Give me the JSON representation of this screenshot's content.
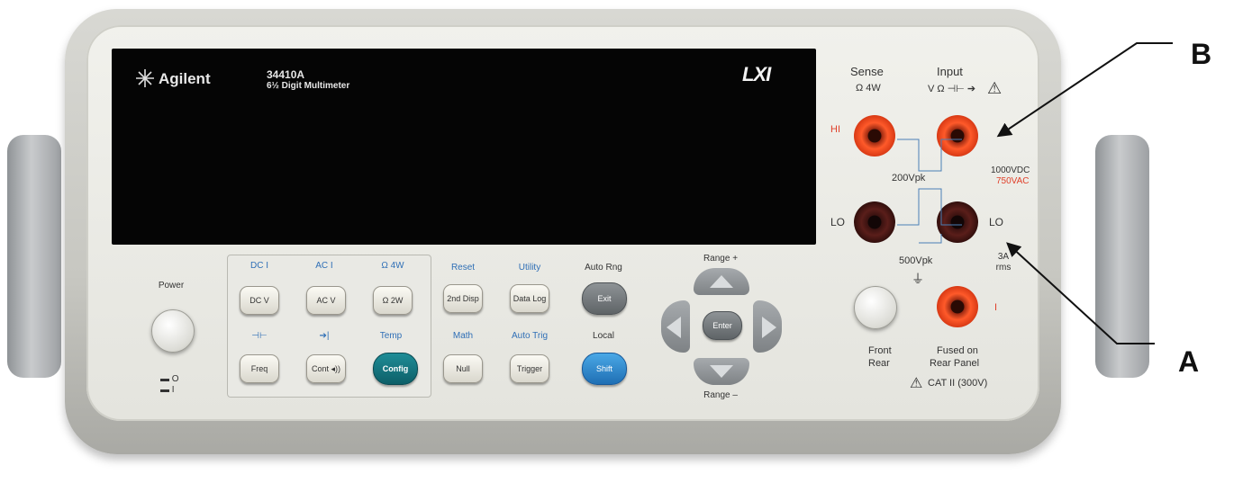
{
  "brand": {
    "name": "Agilent",
    "model": "34410A",
    "description": "6½ Digit Multimeter",
    "lxi_logo": "LXI"
  },
  "power": {
    "label": "Power",
    "on_symbol": "▬ O",
    "off_symbol": "▬ I"
  },
  "function_keys": [
    {
      "top_label": "DC I",
      "key": "DC V"
    },
    {
      "top_label": "AC I",
      "key": "AC V"
    },
    {
      "top_label": "Ω 4W",
      "key": "Ω 2W"
    },
    {
      "top_label": "⊣⊢",
      "key": "Freq"
    },
    {
      "top_label": "➔|",
      "key": "Cont ◂))"
    },
    {
      "top_label": "Temp",
      "key": "Config"
    }
  ],
  "system_keys": [
    {
      "top_label": "Reset",
      "key": "2nd Disp"
    },
    {
      "top_label": "Utility",
      "key": "Data Log"
    },
    {
      "top_label": "Auto Rng",
      "key": "Exit"
    },
    {
      "top_label": "Math",
      "key": "Null"
    },
    {
      "top_label": "Auto Trig",
      "key": "Trigger"
    },
    {
      "top_label": "Local",
      "key": "Shift"
    }
  ],
  "nav": {
    "range_plus": "Range +",
    "range_minus": "Range –",
    "enter": "Enter"
  },
  "terminals": {
    "sense": "Sense",
    "sense_sub": "Ω 4W",
    "input": "Input",
    "input_sub": "V Ω ⊣⊢ ➔",
    "warning": "⚠",
    "hi": "HI",
    "lo_left": "LO",
    "lo_right": "LO",
    "vpk_200": "200Vpk",
    "vdc": "1000VDC",
    "vac": "750VAC",
    "vpk_500": "500Vpk",
    "rms": "3A rms",
    "current": "I",
    "front": "Front",
    "rear": "Rear",
    "fused_1": "Fused on",
    "fused_2": "Rear Panel",
    "cat": "CAT II (300V)"
  },
  "callouts": {
    "b": "B",
    "a": "A"
  },
  "colors": {
    "terminal_red": "#ff5a2a",
    "label_blue": "#2f6fb6",
    "teal_key": "#0d5f68",
    "shift_blue": "#1f6fb4"
  }
}
